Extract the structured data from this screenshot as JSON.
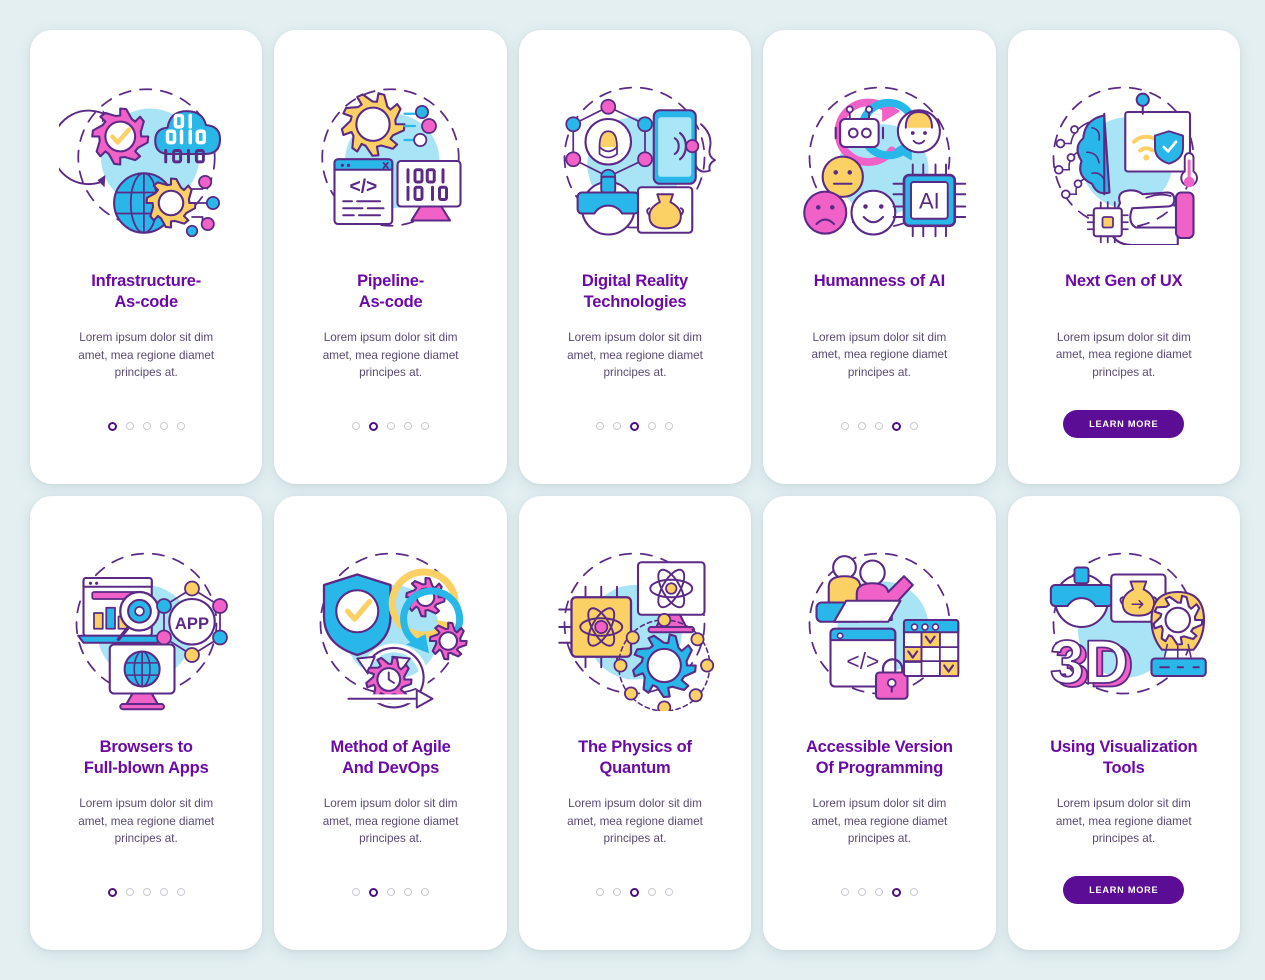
{
  "palette": {
    "background": "#e3eff1",
    "card": "#ffffff",
    "title": "#6b0ba6",
    "body_text": "#5a4a72",
    "dot_active": "#4b0f86",
    "dot_inactive": "#c9c9d4",
    "button_bg": "#5c0d96",
    "button_text": "#ffffff",
    "ill_pink": "#f062c8",
    "ill_magenta": "#ef5bb5",
    "ill_cyan": "#29b6e8",
    "ill_light_cyan": "#a9e6f7",
    "ill_yellow": "#fbd065",
    "ill_outline": "#5b2a86",
    "ill_blob": "#a8e4f5"
  },
  "body_text_default": "Lorem ipsum dolor sit dim\namet, mea regione diamet\nprincipes at.",
  "learn_more_label": "LEARN MORE",
  "dots_total": 5,
  "screens": [
    {
      "id": "infrastructure-as-code",
      "title": "Infrastructure-\nAs-code",
      "body": "Lorem ipsum dolor sit dim\namet, mea regione diamet\nprincipes at.",
      "active_dot": 0,
      "footer": "dots",
      "illustration": "infrastructure-as-code-illustration"
    },
    {
      "id": "pipeline-as-code",
      "title": "Pipeline-\nAs-code",
      "body": "Lorem ipsum dolor sit dim\namet, mea regione diamet\nprincipes at.",
      "active_dot": 1,
      "footer": "dots",
      "illustration": "pipeline-as-code-illustration"
    },
    {
      "id": "digital-reality-technologies",
      "title": "Digital Reality\nTechnologies",
      "body": "Lorem ipsum dolor sit dim\namet, mea regione diamet\nprincipes at.",
      "active_dot": 2,
      "footer": "dots",
      "illustration": "digital-reality-illustration"
    },
    {
      "id": "humanness-of-ai",
      "title": "Humanness of AI",
      "body": "Lorem ipsum dolor sit dim\namet, mea regione diamet\nprincipes at.",
      "active_dot": 3,
      "footer": "dots",
      "illustration": "humanness-of-ai-illustration"
    },
    {
      "id": "next-gen-of-ux",
      "title": "Next Gen of UX",
      "body": "Lorem ipsum dolor sit dim\namet, mea regione diamet\nprincipes at.",
      "active_dot": 4,
      "footer": "button",
      "illustration": "next-gen-of-ux-illustration"
    },
    {
      "id": "browsers-to-full-blown-apps",
      "title": "Browsers to\nFull-blown Apps",
      "body": "Lorem ipsum dolor sit dim\namet, mea regione diamet\nprincipes at.",
      "active_dot": 0,
      "footer": "dots",
      "illustration": "browsers-to-apps-illustration"
    },
    {
      "id": "method-of-agile-and-devops",
      "title": "Method of Agile\nAnd DevOps",
      "body": "Lorem ipsum dolor sit dim\namet, mea regione diamet\nprincipes at.",
      "active_dot": 1,
      "footer": "dots",
      "illustration": "agile-devops-illustration"
    },
    {
      "id": "the-physics-of-quantum",
      "title": "The Physics of\nQuantum",
      "body": "Lorem ipsum dolor sit dim\namet, mea regione diamet\nprincipes at.",
      "active_dot": 2,
      "footer": "dots",
      "illustration": "quantum-physics-illustration"
    },
    {
      "id": "accessible-version-of-programming",
      "title": "Accessible Version\nOf Programming",
      "body": "Lorem ipsum dolor sit dim\namet, mea regione diamet\nprincipes at.",
      "active_dot": 3,
      "footer": "dots",
      "illustration": "accessible-programming-illustration"
    },
    {
      "id": "using-visualization-tools",
      "title": "Using Visualization\nTools",
      "body": "Lorem ipsum dolor sit dim\namet, mea regione diamet\nprincipes at.",
      "active_dot": 4,
      "footer": "button",
      "illustration": "visualization-tools-illustration"
    }
  ]
}
